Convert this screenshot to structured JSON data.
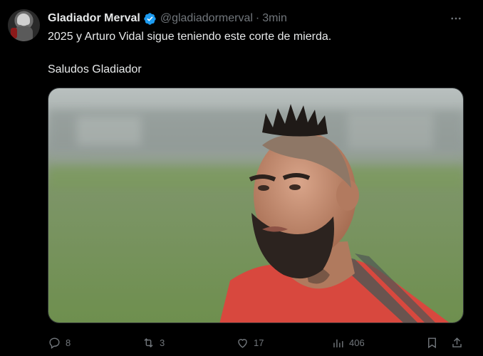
{
  "tweet": {
    "author_name": "Gladiador Merval",
    "handle": "@gladiadormerval",
    "separator": "·",
    "time": "3min",
    "text_line1": "2025 y Arturo Vidal sigue teniendo este corte de mierda.",
    "text_line2": "Saludos Gladiador",
    "verified_color": "#1d9bf0"
  },
  "actions": {
    "replies": "8",
    "retweets": "3",
    "likes": "17",
    "views": "406"
  },
  "icons": [
    "more-icon",
    "verified-icon",
    "reply-icon",
    "retweet-icon",
    "like-icon",
    "views-icon",
    "bookmark-icon",
    "share-icon"
  ],
  "colors": {
    "background": "#000000",
    "text": "#e7e9ea",
    "muted": "#71767b",
    "accent": "#1d9bf0"
  }
}
